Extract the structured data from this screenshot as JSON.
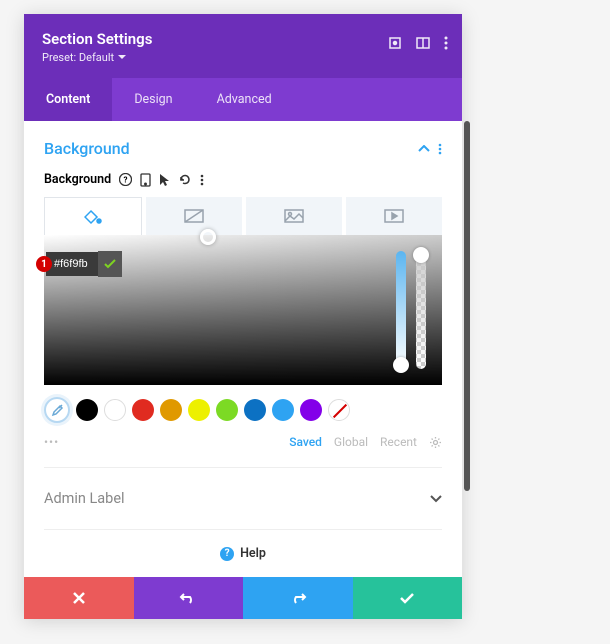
{
  "header": {
    "title": "Section Settings",
    "preset_label": "Preset: Default"
  },
  "tabs": {
    "content": "Content",
    "design": "Design",
    "advanced": "Advanced"
  },
  "background_section": {
    "title": "Background",
    "group_label": "Background"
  },
  "color_picker": {
    "hex_value": "#f6f9fb",
    "badge_number": "1",
    "swatches": [
      {
        "name": "black",
        "color": "#000000"
      },
      {
        "name": "white",
        "color": "#ffffff",
        "border": true
      },
      {
        "name": "red",
        "color": "#e02b20"
      },
      {
        "name": "orange",
        "color": "#e09900"
      },
      {
        "name": "yellow",
        "color": "#edf000"
      },
      {
        "name": "green",
        "color": "#7cda24"
      },
      {
        "name": "cyan",
        "color": "#0c71c3"
      },
      {
        "name": "blue",
        "color": "#2ea3f2"
      },
      {
        "name": "purple",
        "color": "#8300e9"
      }
    ]
  },
  "meta": {
    "saved": "Saved",
    "global": "Global",
    "recent": "Recent"
  },
  "admin_label": {
    "title": "Admin Label"
  },
  "help": {
    "label": "Help"
  },
  "icons": {
    "expand": "expand-icon",
    "columns": "columns-icon",
    "more": "more-vertical-icon",
    "chevron_down": "chevron-down-icon",
    "chevron_up": "chevron-up-icon",
    "question": "question-icon",
    "device": "device-icon",
    "cursor": "cursor-icon",
    "reset": "reset-icon",
    "color_fill": "color-fill-icon",
    "gradient": "gradient-icon",
    "image": "image-icon",
    "video": "video-icon",
    "eyedropper": "eyedropper-icon",
    "gear": "gear-icon",
    "close": "close-icon",
    "undo": "undo-icon",
    "redo": "redo-icon",
    "check": "check-icon"
  }
}
